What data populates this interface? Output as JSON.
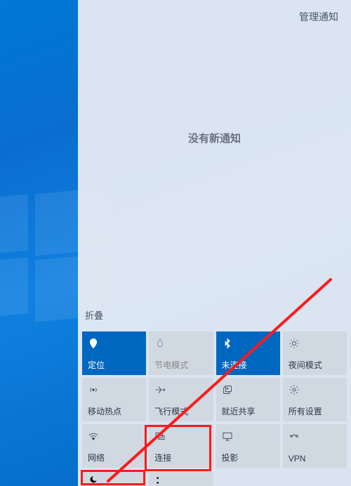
{
  "header": {
    "manage_label": "管理通知"
  },
  "empty": {
    "message": "没有新通知"
  },
  "collapse_label": "折叠",
  "tiles": [
    {
      "id": "location",
      "icon": "location-icon",
      "label": "定位",
      "active": true
    },
    {
      "id": "battery-saver",
      "icon": "battery-saver-icon",
      "label": "节电模式",
      "active": false,
      "disabled": true
    },
    {
      "id": "bluetooth",
      "icon": "bluetooth-icon",
      "label": "未连接",
      "active": true
    },
    {
      "id": "night-light",
      "icon": "night-light-icon",
      "label": "夜间模式",
      "active": false
    },
    {
      "id": "hotspot",
      "icon": "hotspot-icon",
      "label": "移动热点",
      "active": false
    },
    {
      "id": "airplane",
      "icon": "airplane-icon",
      "label": "飞行模式",
      "active": false
    },
    {
      "id": "nearby-share",
      "icon": "nearby-share-icon",
      "label": "就近共享",
      "active": false
    },
    {
      "id": "all-settings",
      "icon": "settings-icon",
      "label": "所有设置",
      "active": false
    },
    {
      "id": "network",
      "icon": "network-icon",
      "label": "网络",
      "active": false
    },
    {
      "id": "connect",
      "icon": "connect-icon",
      "label": "连接",
      "active": false
    },
    {
      "id": "project",
      "icon": "project-icon",
      "label": "投影",
      "active": false
    },
    {
      "id": "vpn",
      "icon": "vpn-icon",
      "label": "VPN",
      "active": false
    }
  ],
  "tiles_stub": [
    {
      "id": "focus-assist",
      "icon": "focus-assist-icon"
    },
    {
      "id": "screen-snip",
      "icon": "screen-snip-icon"
    }
  ],
  "annotations": {
    "highlight_tile": "focus-assist",
    "arrow": true
  }
}
